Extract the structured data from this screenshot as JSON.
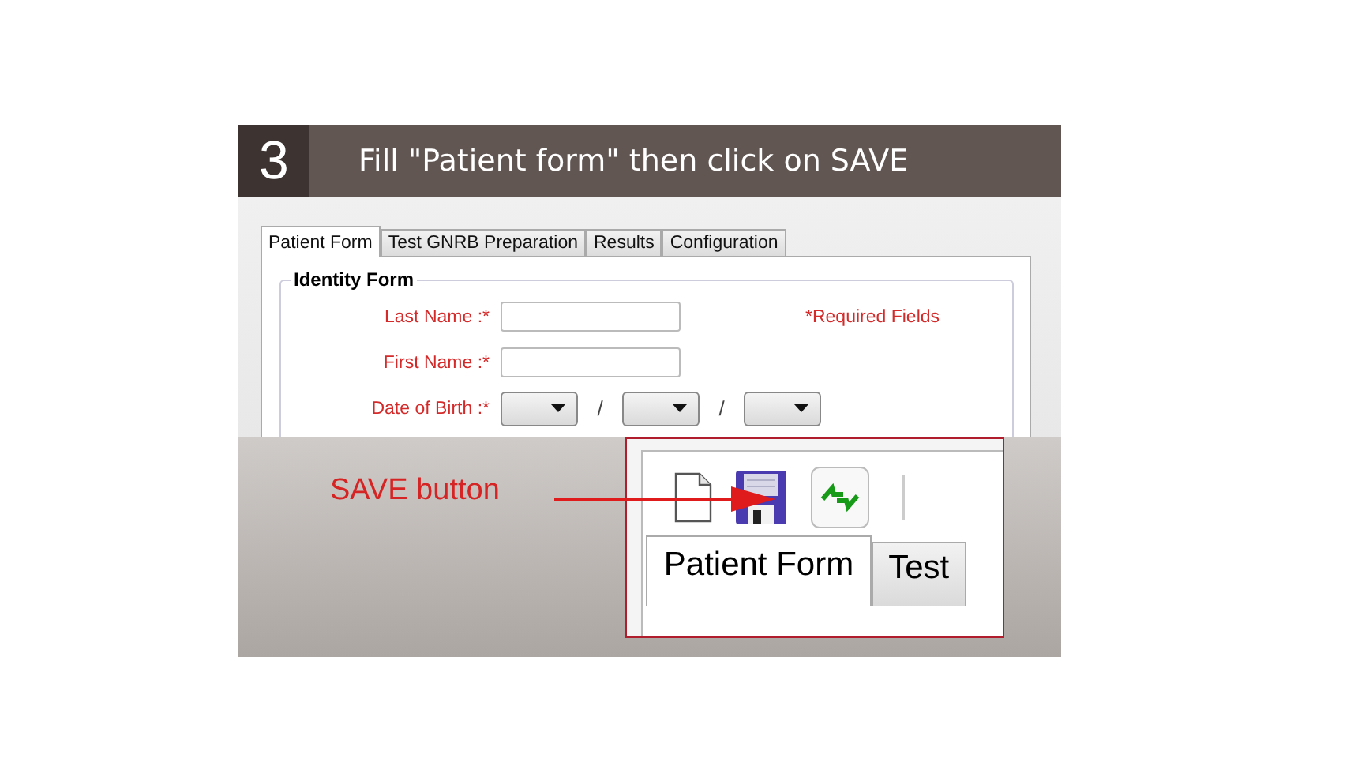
{
  "step": {
    "number": "3",
    "title": "Fill \"Patient form\" then click on SAVE"
  },
  "form": {
    "tabs": [
      {
        "label": "Patient Form",
        "selected": true
      },
      {
        "label": "Test GNRB Preparation",
        "selected": false
      },
      {
        "label": "Results",
        "selected": false
      },
      {
        "label": "Configuration",
        "selected": false
      }
    ],
    "group_title": "Identity Form",
    "fields": [
      {
        "kind": "text",
        "label": "Last Name :*"
      },
      {
        "kind": "text",
        "label": "First Name :*"
      },
      {
        "kind": "date",
        "label": "Date of Birth :*",
        "separators": [
          "/",
          "/"
        ]
      }
    ],
    "required_note": "*Required Fields"
  },
  "callout": {
    "label": "SAVE button"
  },
  "zoom_inset": {
    "tabs": [
      {
        "label": "Patient Form",
        "selected": true
      },
      {
        "label": "Test",
        "selected": false
      }
    ]
  }
}
